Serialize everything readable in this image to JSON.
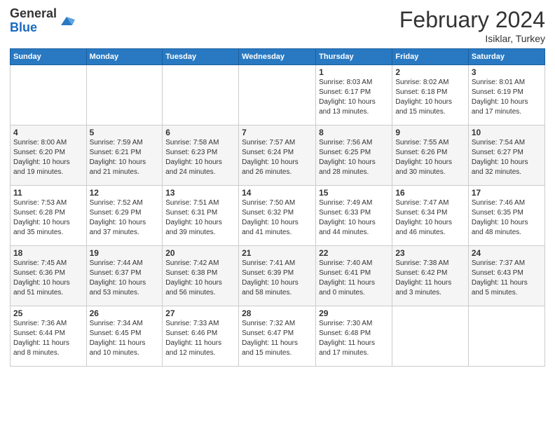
{
  "header": {
    "logo_general": "General",
    "logo_blue": "Blue",
    "title": "February 2024",
    "location": "Isiklar, Turkey"
  },
  "weekdays": [
    "Sunday",
    "Monday",
    "Tuesday",
    "Wednesday",
    "Thursday",
    "Friday",
    "Saturday"
  ],
  "weeks": [
    [
      {
        "day": "",
        "info": ""
      },
      {
        "day": "",
        "info": ""
      },
      {
        "day": "",
        "info": ""
      },
      {
        "day": "",
        "info": ""
      },
      {
        "day": "1",
        "info": "Sunrise: 8:03 AM\nSunset: 6:17 PM\nDaylight: 10 hours\nand 13 minutes."
      },
      {
        "day": "2",
        "info": "Sunrise: 8:02 AM\nSunset: 6:18 PM\nDaylight: 10 hours\nand 15 minutes."
      },
      {
        "day": "3",
        "info": "Sunrise: 8:01 AM\nSunset: 6:19 PM\nDaylight: 10 hours\nand 17 minutes."
      }
    ],
    [
      {
        "day": "4",
        "info": "Sunrise: 8:00 AM\nSunset: 6:20 PM\nDaylight: 10 hours\nand 19 minutes."
      },
      {
        "day": "5",
        "info": "Sunrise: 7:59 AM\nSunset: 6:21 PM\nDaylight: 10 hours\nand 21 minutes."
      },
      {
        "day": "6",
        "info": "Sunrise: 7:58 AM\nSunset: 6:23 PM\nDaylight: 10 hours\nand 24 minutes."
      },
      {
        "day": "7",
        "info": "Sunrise: 7:57 AM\nSunset: 6:24 PM\nDaylight: 10 hours\nand 26 minutes."
      },
      {
        "day": "8",
        "info": "Sunrise: 7:56 AM\nSunset: 6:25 PM\nDaylight: 10 hours\nand 28 minutes."
      },
      {
        "day": "9",
        "info": "Sunrise: 7:55 AM\nSunset: 6:26 PM\nDaylight: 10 hours\nand 30 minutes."
      },
      {
        "day": "10",
        "info": "Sunrise: 7:54 AM\nSunset: 6:27 PM\nDaylight: 10 hours\nand 32 minutes."
      }
    ],
    [
      {
        "day": "11",
        "info": "Sunrise: 7:53 AM\nSunset: 6:28 PM\nDaylight: 10 hours\nand 35 minutes."
      },
      {
        "day": "12",
        "info": "Sunrise: 7:52 AM\nSunset: 6:29 PM\nDaylight: 10 hours\nand 37 minutes."
      },
      {
        "day": "13",
        "info": "Sunrise: 7:51 AM\nSunset: 6:31 PM\nDaylight: 10 hours\nand 39 minutes."
      },
      {
        "day": "14",
        "info": "Sunrise: 7:50 AM\nSunset: 6:32 PM\nDaylight: 10 hours\nand 41 minutes."
      },
      {
        "day": "15",
        "info": "Sunrise: 7:49 AM\nSunset: 6:33 PM\nDaylight: 10 hours\nand 44 minutes."
      },
      {
        "day": "16",
        "info": "Sunrise: 7:47 AM\nSunset: 6:34 PM\nDaylight: 10 hours\nand 46 minutes."
      },
      {
        "day": "17",
        "info": "Sunrise: 7:46 AM\nSunset: 6:35 PM\nDaylight: 10 hours\nand 48 minutes."
      }
    ],
    [
      {
        "day": "18",
        "info": "Sunrise: 7:45 AM\nSunset: 6:36 PM\nDaylight: 10 hours\nand 51 minutes."
      },
      {
        "day": "19",
        "info": "Sunrise: 7:44 AM\nSunset: 6:37 PM\nDaylight: 10 hours\nand 53 minutes."
      },
      {
        "day": "20",
        "info": "Sunrise: 7:42 AM\nSunset: 6:38 PM\nDaylight: 10 hours\nand 56 minutes."
      },
      {
        "day": "21",
        "info": "Sunrise: 7:41 AM\nSunset: 6:39 PM\nDaylight: 10 hours\nand 58 minutes."
      },
      {
        "day": "22",
        "info": "Sunrise: 7:40 AM\nSunset: 6:41 PM\nDaylight: 11 hours\nand 0 minutes."
      },
      {
        "day": "23",
        "info": "Sunrise: 7:38 AM\nSunset: 6:42 PM\nDaylight: 11 hours\nand 3 minutes."
      },
      {
        "day": "24",
        "info": "Sunrise: 7:37 AM\nSunset: 6:43 PM\nDaylight: 11 hours\nand 5 minutes."
      }
    ],
    [
      {
        "day": "25",
        "info": "Sunrise: 7:36 AM\nSunset: 6:44 PM\nDaylight: 11 hours\nand 8 minutes."
      },
      {
        "day": "26",
        "info": "Sunrise: 7:34 AM\nSunset: 6:45 PM\nDaylight: 11 hours\nand 10 minutes."
      },
      {
        "day": "27",
        "info": "Sunrise: 7:33 AM\nSunset: 6:46 PM\nDaylight: 11 hours\nand 12 minutes."
      },
      {
        "day": "28",
        "info": "Sunrise: 7:32 AM\nSunset: 6:47 PM\nDaylight: 11 hours\nand 15 minutes."
      },
      {
        "day": "29",
        "info": "Sunrise: 7:30 AM\nSunset: 6:48 PM\nDaylight: 11 hours\nand 17 minutes."
      },
      {
        "day": "",
        "info": ""
      },
      {
        "day": "",
        "info": ""
      }
    ]
  ]
}
